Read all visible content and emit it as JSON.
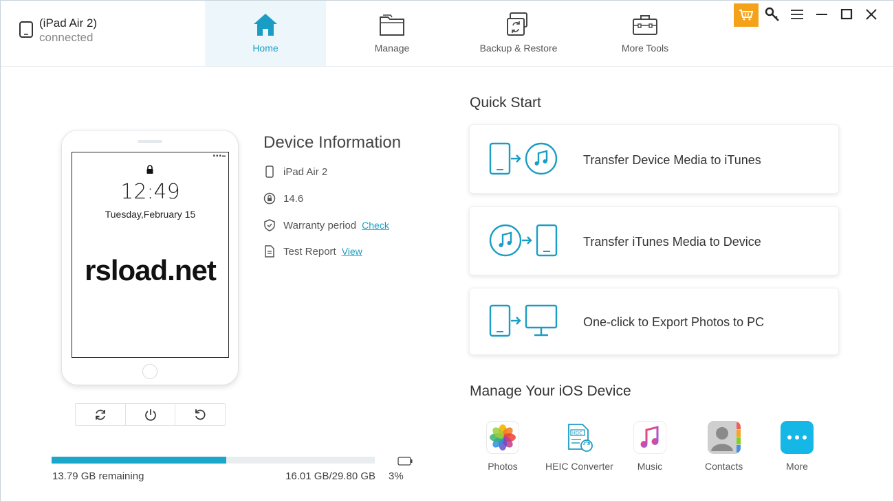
{
  "device": {
    "name": "(iPad Air 2)",
    "status": "connected"
  },
  "nav": {
    "tabs": [
      {
        "label": "Home",
        "icon": "home-icon",
        "active": true
      },
      {
        "label": "Manage",
        "icon": "folder-icon",
        "active": false
      },
      {
        "label": "Backup & Restore",
        "icon": "backup-restore-icon",
        "active": false
      },
      {
        "label": "More Tools",
        "icon": "toolbox-icon",
        "active": false
      }
    ]
  },
  "window_controls": [
    "cart-icon",
    "key-icon",
    "menu-icon",
    "minimize-icon",
    "maximize-icon",
    "close-icon"
  ],
  "lockscreen": {
    "time": "12:49",
    "date": "Tuesday,February 15",
    "watermark": "rsload.net"
  },
  "device_actions": [
    "refresh-icon",
    "power-icon",
    "restart-icon"
  ],
  "storage": {
    "remaining": "13.79 GB remaining",
    "used": "16.01 GB/29.80 GB",
    "used_fraction": 0.54,
    "battery": "3%"
  },
  "device_info": {
    "title": "Device Information",
    "model": "iPad Air 2",
    "ios_version": "14.6",
    "warranty_label": "Warranty period",
    "warranty_link": "Check",
    "report_label": "Test Report",
    "report_link": "View"
  },
  "quick_start": {
    "title": "Quick Start",
    "cards": [
      {
        "label": "Transfer Device Media to iTunes"
      },
      {
        "label": "Transfer iTunes Media to Device"
      },
      {
        "label": "One-click to Export Photos to PC"
      }
    ]
  },
  "manage": {
    "title": "Manage Your iOS Device",
    "items": [
      {
        "label": "Photos",
        "icon": "photos-icon"
      },
      {
        "label": "HEIC Converter",
        "icon": "heic-converter-icon"
      },
      {
        "label": "Music",
        "icon": "music-icon"
      },
      {
        "label": "Contacts",
        "icon": "contacts-icon"
      },
      {
        "label": "More",
        "icon": "more-icon"
      }
    ]
  },
  "colors": {
    "accent": "#1a9dc4",
    "cart": "#f5a21b"
  }
}
